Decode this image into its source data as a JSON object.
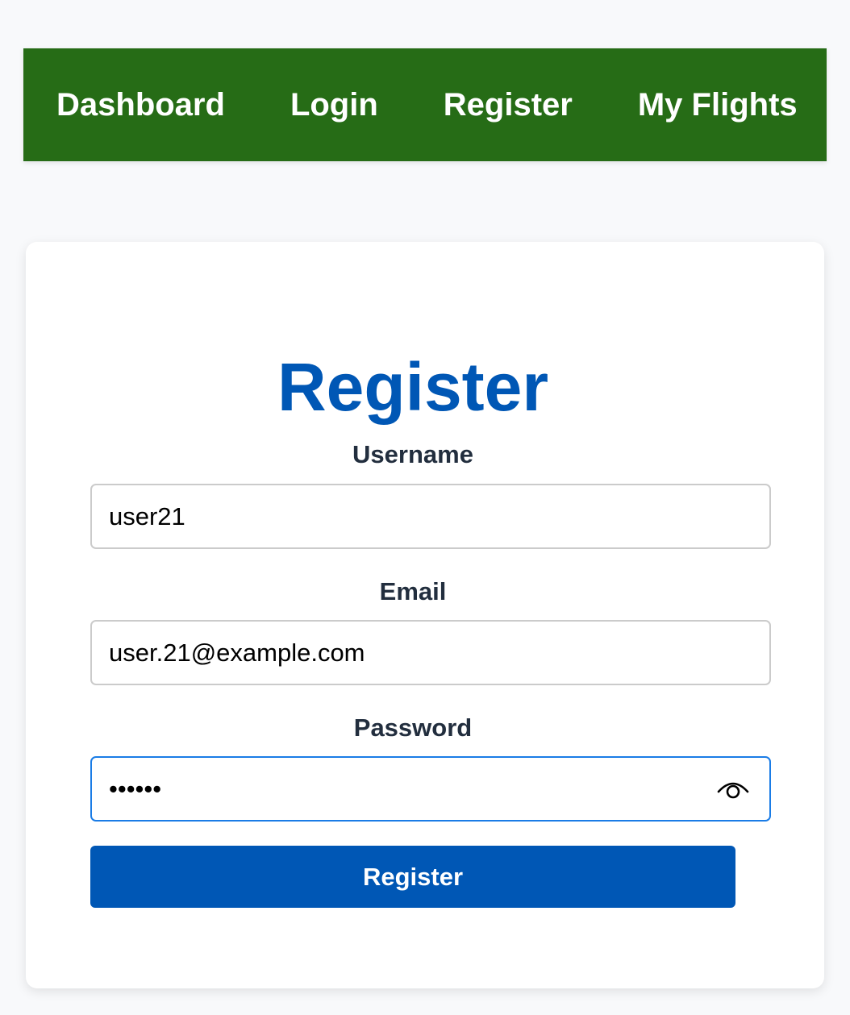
{
  "nav": {
    "links": [
      {
        "label": "Dashboard"
      },
      {
        "label": "Login"
      },
      {
        "label": "Register"
      },
      {
        "label": "My Flights"
      }
    ],
    "background_color": "#266c16"
  },
  "form": {
    "title": "Register",
    "title_color": "#0057b5",
    "username": {
      "label": "Username",
      "value": "user21"
    },
    "email": {
      "label": "Email",
      "value": "user.21@example.com"
    },
    "password": {
      "label": "Password",
      "masked_value": "••••••",
      "toggle_icon": "eye-icon"
    },
    "submit_label": "Register",
    "button_color": "#0057b5"
  }
}
